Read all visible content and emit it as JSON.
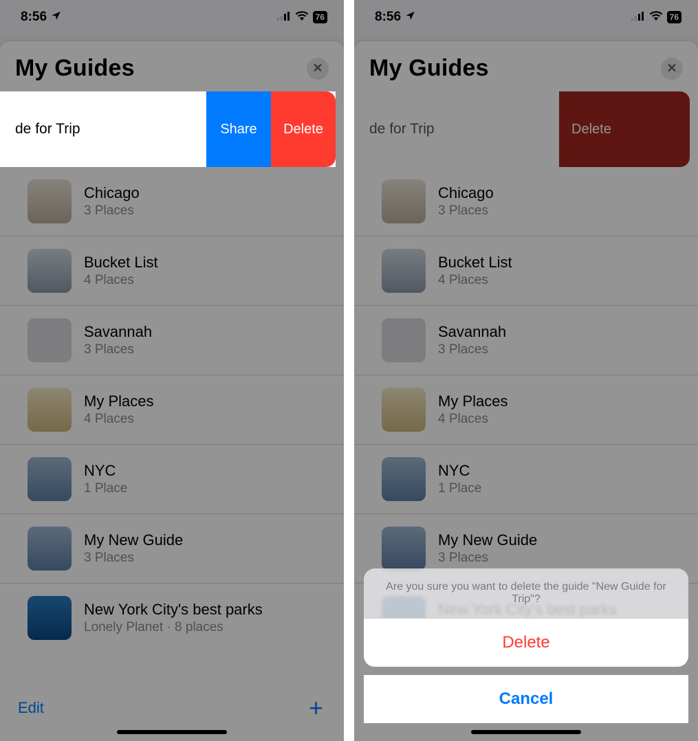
{
  "status": {
    "time": "8:56",
    "battery": "76"
  },
  "header": {
    "title": "My Guides"
  },
  "swiped": {
    "partial_title": "de for Trip",
    "share": "Share",
    "delete": "Delete"
  },
  "guides": [
    {
      "title": "Chicago",
      "subtitle": "3 Places"
    },
    {
      "title": "Bucket List",
      "subtitle": "4 Places"
    },
    {
      "title": "Savannah",
      "subtitle": "3 Places"
    },
    {
      "title": "My Places",
      "subtitle": "4 Places"
    },
    {
      "title": "NYC",
      "subtitle": "1 Place"
    },
    {
      "title": "My New Guide",
      "subtitle": "3 Places"
    },
    {
      "title": "New York City's best parks",
      "subtitle": "Lonely Planet · 8 places"
    }
  ],
  "toolbar": {
    "edit": "Edit"
  },
  "confirm": {
    "message": "Are you sure you want to delete the guide \"New Guide for Trip\"?",
    "delete": "Delete",
    "cancel": "Cancel"
  }
}
